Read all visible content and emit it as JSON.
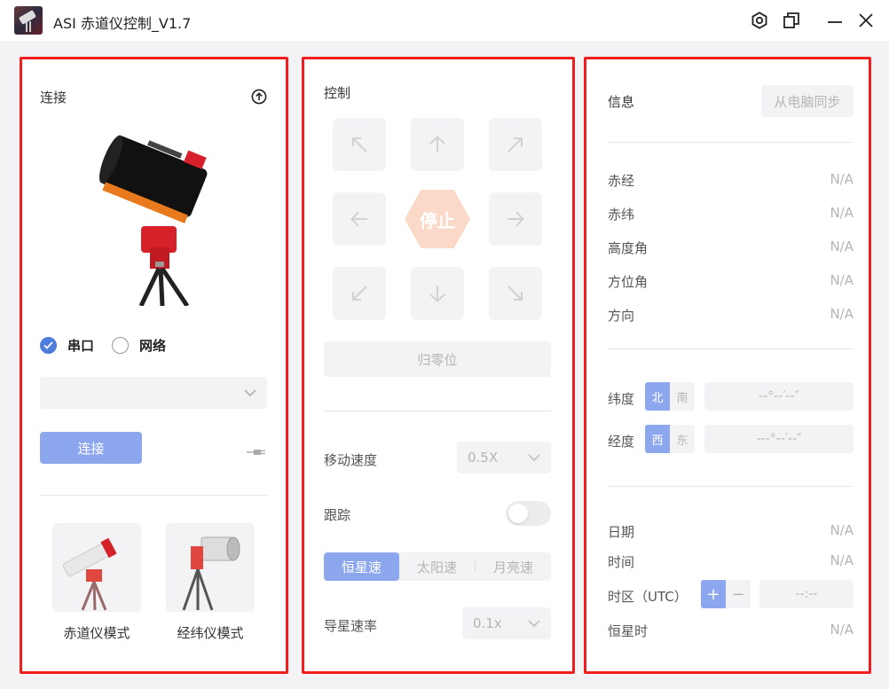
{
  "window": {
    "title": "ASI 赤道仪控制_V1.7"
  },
  "connection": {
    "title": "连接",
    "radio_serial": "串口",
    "radio_network": "网络",
    "port_select_value": "",
    "connect_button": "连接",
    "mode_equatorial": "赤道仪模式",
    "mode_altaz": "经纬仪模式"
  },
  "control": {
    "title": "控制",
    "stop_button": "停止",
    "home_button": "归零位",
    "move_speed_label": "移动速度",
    "move_speed_value": "0.5X",
    "tracking_label": "跟踪",
    "tracking_on": false,
    "tracking_rates": [
      "恒星速",
      "太阳速",
      "月亮速"
    ],
    "tracking_rate_selected": "恒星速",
    "guide_rate_label": "导星速率",
    "guide_rate_value": "0.1x"
  },
  "info": {
    "title": "信息",
    "sync_button": "从电脑同步",
    "ra_label": "赤经",
    "ra_value": "N/A",
    "dec_label": "赤纬",
    "dec_value": "N/A",
    "alt_label": "高度角",
    "alt_value": "N/A",
    "az_label": "方位角",
    "az_value": "N/A",
    "dir_label": "方向",
    "dir_value": "N/A",
    "lat_label": "纬度",
    "lat_north": "北",
    "lat_south": "南",
    "lat_placeholder": "--°--′--″",
    "lon_label": "经度",
    "lon_west": "西",
    "lon_east": "东",
    "lon_placeholder": "---°--′--″",
    "date_label": "日期",
    "date_value": "N/A",
    "time_label": "时间",
    "time_value": "N/A",
    "tz_label": "时区（UTC）",
    "tz_plus": "+",
    "tz_minus": "−",
    "tz_placeholder": "--:--",
    "sidereal_label": "恒星时",
    "sidereal_value": "N/A"
  },
  "colors": {
    "accent": "#8da7ee",
    "highlight_border": "#f01e1e",
    "stop": "#fbd9c8"
  }
}
